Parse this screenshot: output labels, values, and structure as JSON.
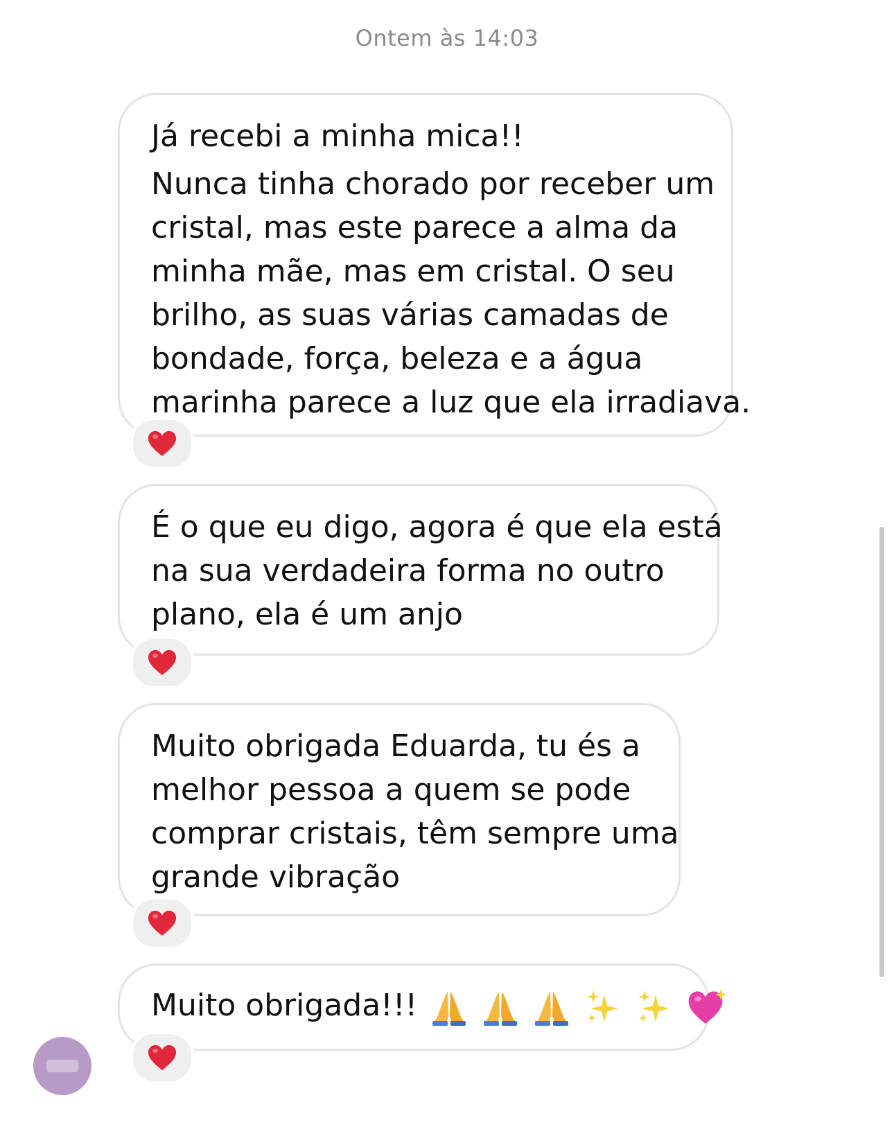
{
  "thread": {
    "timestamp": "Ontem às 14:03"
  },
  "messages": [
    {
      "first_line": "Já recebi a minha mica!!",
      "lines": [
        "Nunca tinha chorado por receber um",
        "cristal, mas este parece a alma da",
        "minha mãe, mas em cristal. O seu",
        "brilho, as suas várias camadas de",
        "bondade, força, beleza e a água",
        "marinha parece a luz que ela irradiava."
      ],
      "reaction": "heart-icon"
    },
    {
      "lines": [
        "É o que eu digo, agora é que ela está",
        "na sua verdadeira forma no outro",
        "plano, ela é um anjo"
      ],
      "reaction": "heart-icon"
    },
    {
      "lines": [
        "Muito obrigada Eduarda, tu és a",
        "melhor pessoa a quem se pode",
        "comprar cristais, têm sempre uma",
        "grande vibração"
      ],
      "reaction": "heart-icon"
    },
    {
      "text": "Muito obrigada!!!",
      "emojis": [
        "folded-hands-icon",
        "folded-hands-icon",
        "folded-hands-icon",
        "sparkles-icon",
        "sparkles-icon",
        "sparkling-heart-icon"
      ],
      "reaction": "heart-icon"
    }
  ],
  "colors": {
    "bubble_border": "#e3e3e6",
    "reaction_bg": "#efefef",
    "heart": "#e0283a",
    "avatar": "#b79bc6",
    "timestamp": "#8a8a8e"
  }
}
